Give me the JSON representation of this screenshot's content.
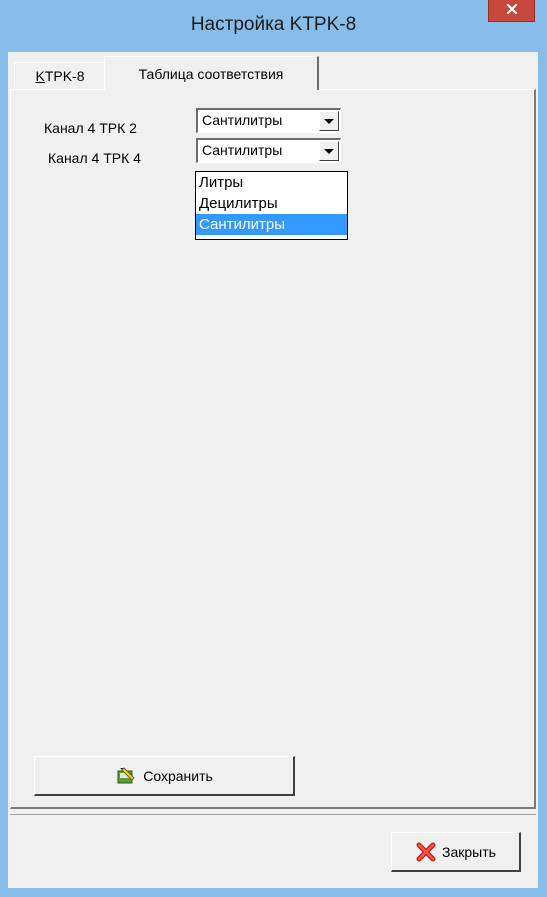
{
  "window": {
    "title": "Настройка KTPK-8"
  },
  "tabs": [
    {
      "label_accel": "K",
      "label_rest": "TPK-8",
      "active": false
    },
    {
      "label": "Таблица соответствия",
      "active": true
    }
  ],
  "rows": [
    {
      "label": "Канал 4 ТРК 2",
      "value": "Сантилитры"
    },
    {
      "label": "Канал 4 ТРК 4",
      "value": "Сантилитры"
    }
  ],
  "dropdown": {
    "options": [
      "Литры",
      "Децилитры",
      "Сантилитры"
    ],
    "selected": "Сантилитры"
  },
  "buttons": {
    "save_label": "Сохранить",
    "close_label": "Закрыть"
  },
  "icons": {
    "save": "save-icon",
    "close": "close-x-icon",
    "title_close": "close-icon"
  },
  "colors": {
    "titlebar": "#88bce9",
    "close_button": "#c7483c",
    "selection": "#3399ff"
  }
}
